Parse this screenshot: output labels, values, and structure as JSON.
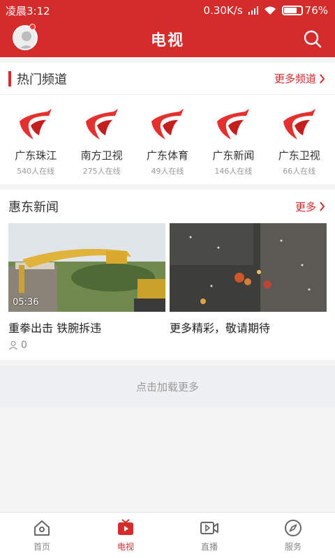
{
  "status": {
    "time": "凌晨3:12",
    "speed": "0.30K/s",
    "battery": "76%",
    "battery_level": 0.76
  },
  "header": {
    "title": "电视"
  },
  "hot_channels": {
    "title": "热门频道",
    "more": "更多频道",
    "items": [
      {
        "name": "广东珠江",
        "viewers": "540人在线"
      },
      {
        "name": "南方卫视",
        "viewers": "275人在线"
      },
      {
        "name": "广东体育",
        "viewers": "49人在线"
      },
      {
        "name": "广东新闻",
        "viewers": "146人在线"
      },
      {
        "name": "广东卫视",
        "viewers": "66人在线"
      }
    ]
  },
  "news": {
    "title": "惠东新闻",
    "more": "更多",
    "items": [
      {
        "caption": "重拳出击 铁腕拆违",
        "duration": "05:36",
        "views": "0"
      },
      {
        "caption": "更多精彩，敬请期待"
      }
    ]
  },
  "load_more": "点击加载更多",
  "nav": {
    "items": [
      {
        "label": "首页",
        "icon": "home-icon"
      },
      {
        "label": "电视",
        "icon": "tv-icon",
        "active": true
      },
      {
        "label": "直播",
        "icon": "live-icon"
      },
      {
        "label": "服务",
        "icon": "compass-icon"
      }
    ]
  },
  "colors": {
    "brand": "#d42b2b"
  }
}
